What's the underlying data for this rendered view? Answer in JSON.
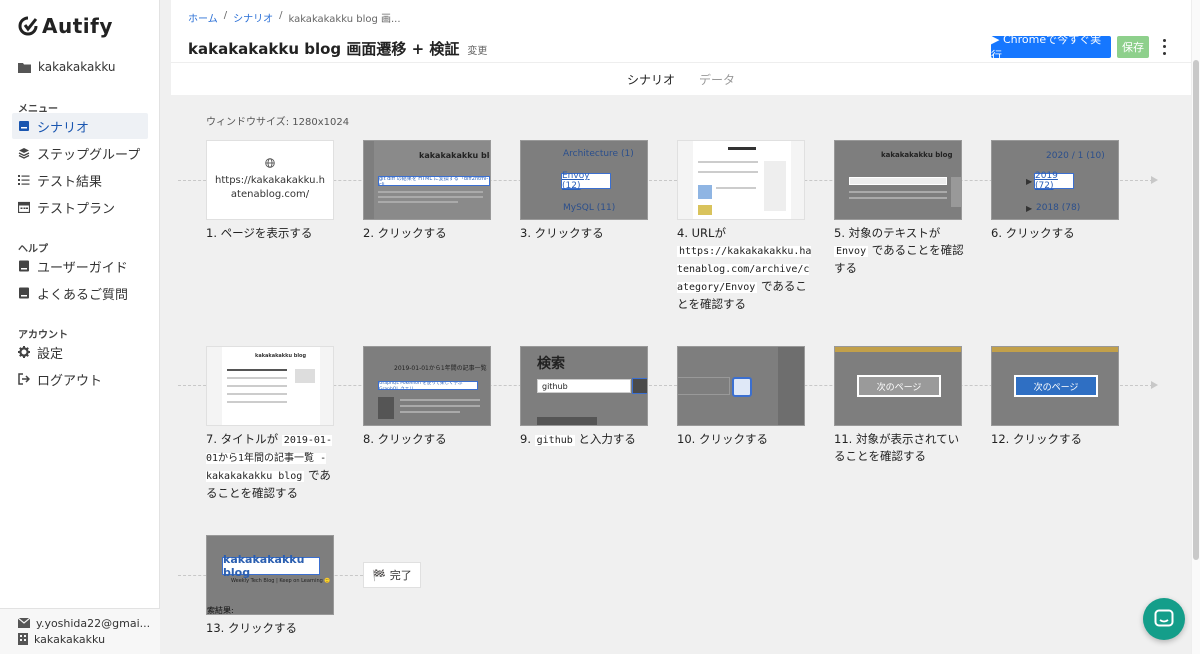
{
  "app": {
    "brand": "Autify",
    "workspace": "kakakakakku"
  },
  "sidebar": {
    "menu_label": "メニュー",
    "help_label": "ヘルプ",
    "account_label": "アカウント",
    "menu": [
      {
        "label": "シナリオ",
        "icon": "scenario-icon",
        "active": true
      },
      {
        "label": "ステップグループ",
        "icon": "layers-icon"
      },
      {
        "label": "テスト結果",
        "icon": "list-icon"
      },
      {
        "label": "テストプラン",
        "icon": "calendar-icon"
      }
    ],
    "help": [
      {
        "label": "ユーザーガイド",
        "icon": "book-icon"
      },
      {
        "label": "よくあるご質問",
        "icon": "book-icon"
      }
    ],
    "account": [
      {
        "label": "設定",
        "icon": "gear-icon"
      },
      {
        "label": "ログアウト",
        "icon": "logout-icon"
      }
    ],
    "footer": {
      "email": "y.yoshida22@gmai...",
      "org": "kakakakakku"
    }
  },
  "header": {
    "breadcrumb": [
      "ホーム",
      "シナリオ",
      "kakakakakku blog 画..."
    ],
    "title": "kakakakakku blog 画面遷移 + 検証",
    "edit_label": "変更",
    "run_button": "▶ Chromeで今すぐ実行",
    "save_button": "保存",
    "tabs": [
      "シナリオ",
      "データ"
    ]
  },
  "content": {
    "window_size": "ウィンドウサイズ: 1280x1024",
    "steps": [
      {
        "num": "1.",
        "text": "ページを表示する",
        "url": "https://kakakakakku.hatenablog.com/"
      },
      {
        "num": "2.",
        "text": "クリックする",
        "thumb_title": "kakakakakku blog",
        "thumb_link": "git diff の結果を HTML に変換する「diff2html-cli..."
      },
      {
        "num": "3.",
        "text": "クリックする",
        "thumb_top": "Architecture (1)",
        "thumb_hl": "Envoy (12)",
        "thumb_bottom": "MySQL (11)"
      },
      {
        "num": "4.",
        "pre": "URLが",
        "code": "https://kakakakakku.hatenablog.com/archive/category/Envoy",
        "post": "であることを確認する"
      },
      {
        "num": "5.",
        "pre": "対象のテキストが",
        "code": "Envoy",
        "post": "であることを確認する",
        "thumb_title": "kakakakakku blog"
      },
      {
        "num": "6.",
        "text": "クリックする",
        "thumb_top": "2020 / 1 (10)",
        "thumb_hl": "2019 (72)",
        "thumb_bottom": "2018 (78)"
      },
      {
        "num": "7.",
        "pre": "タイトルが",
        "code": "2019-01-01から1年間の記事一覧 - kakakakakku blog",
        "post": "であることを確認する",
        "thumb_title": "kakakakakku blog"
      },
      {
        "num": "8.",
        "text": "クリックする",
        "thumb_title": "2019-01-01から1年間の記事一覧",
        "thumb_link": "GraphQL Pokémon を使って楽しく学ぶ GraphQL クエリ"
      },
      {
        "num": "9.",
        "code": "github",
        "post": "と入力する",
        "thumb_title": "検索",
        "thumb_input": "github"
      },
      {
        "num": "10.",
        "text": "クリックする"
      },
      {
        "num": "11.",
        "text": "対象が表示されていることを確認する",
        "thumb_btn": "次のページ"
      },
      {
        "num": "12.",
        "text": "クリックする",
        "thumb_btn": "次のページ"
      },
      {
        "num": "13.",
        "text": "クリックする",
        "thumb_title": "kakakakakku blog",
        "thumb_sub": "Weekly Tech Blog | Keep on Learning 🙂",
        "thumb_result": "索結果:"
      }
    ],
    "finish_label": "完了"
  }
}
